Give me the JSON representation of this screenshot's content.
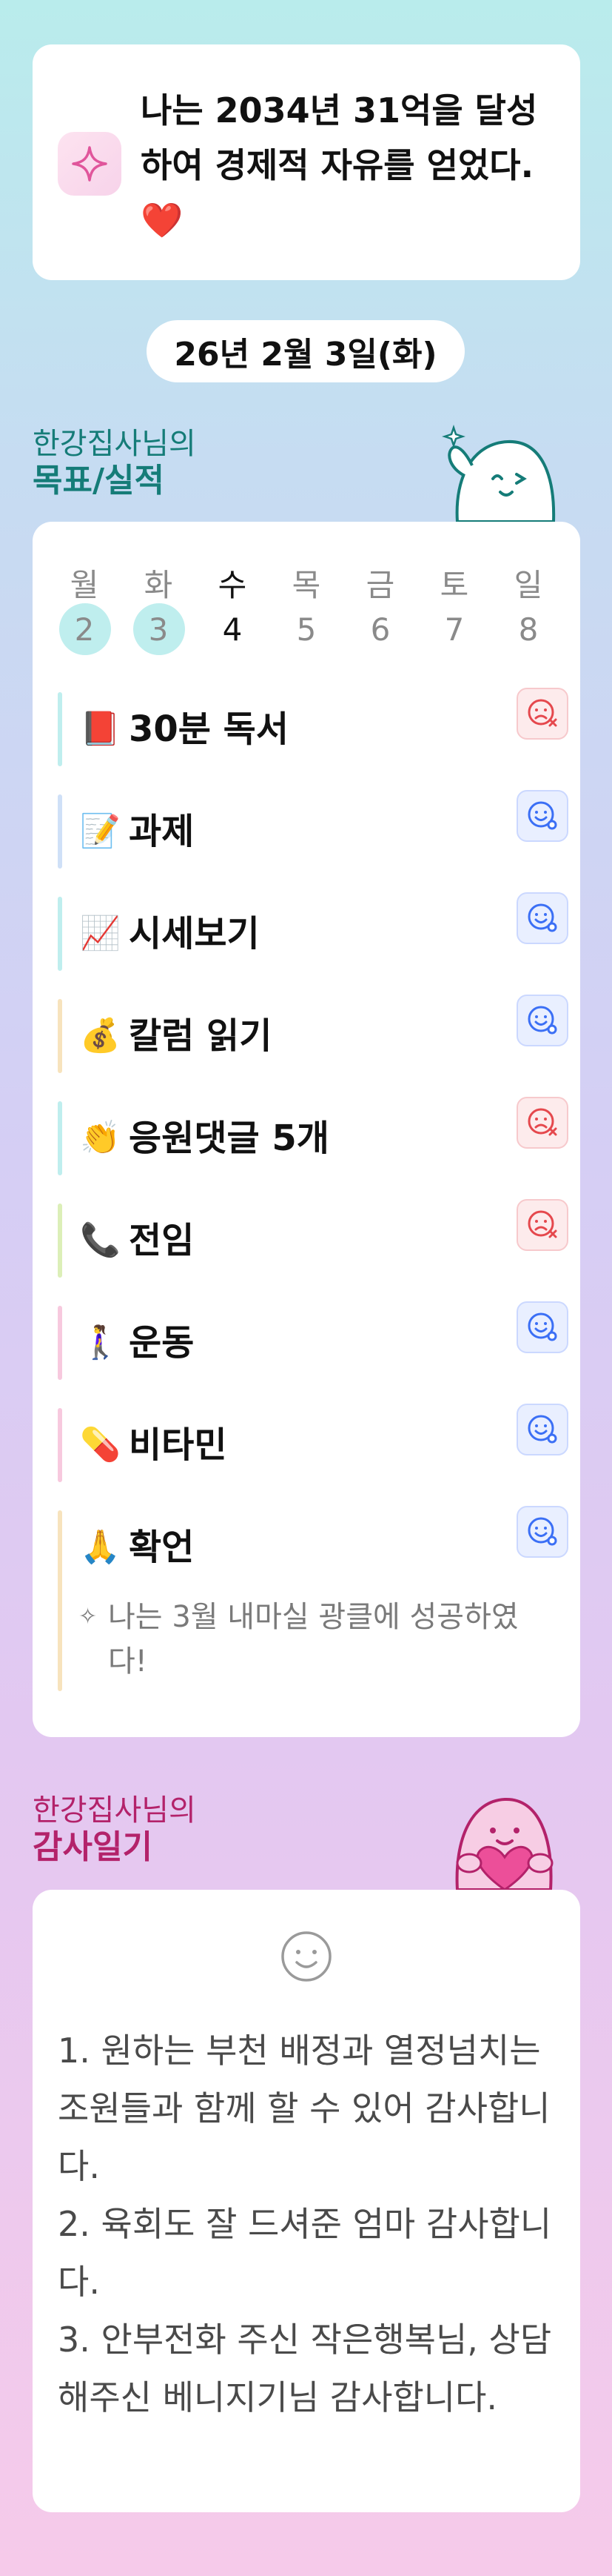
{
  "goal": {
    "text": "나는 2034년 31억을 달성하여 경제적 자유를 얻었다.❤️",
    "icon": "sparkle-icon"
  },
  "date": "26년 2월 3일(화)",
  "goals_section": {
    "subtitle": "한강집사님의",
    "title": "목표/실적"
  },
  "week": [
    {
      "name": "월",
      "num": "2",
      "marked": true,
      "strong": false
    },
    {
      "name": "화",
      "num": "3",
      "marked": true,
      "strong": false
    },
    {
      "name": "수",
      "num": "4",
      "marked": false,
      "strong": true
    },
    {
      "name": "목",
      "num": "5",
      "marked": false,
      "strong": false
    },
    {
      "name": "금",
      "num": "6",
      "marked": false,
      "strong": false
    },
    {
      "name": "토",
      "num": "7",
      "marked": false,
      "strong": false
    },
    {
      "name": "일",
      "num": "8",
      "marked": false,
      "strong": false
    }
  ],
  "tasks": [
    {
      "emoji": "📕",
      "label": "30분 독서",
      "status": "fail",
      "bar_color": "#bfeeee"
    },
    {
      "emoji": "📝",
      "label": "과제",
      "status": "done",
      "bar_color": "#cfe0f7"
    },
    {
      "emoji": "📈",
      "label": "시세보기",
      "status": "done",
      "bar_color": "#bfeeee"
    },
    {
      "emoji": "💰",
      "label": "칼럼 읽기",
      "status": "done",
      "bar_color": "#f7e3bd"
    },
    {
      "emoji": "👏",
      "label": "응원댓글 5개",
      "status": "fail",
      "bar_color": "#bfeeee"
    },
    {
      "emoji": "📞",
      "label": "전임",
      "status": "fail",
      "bar_color": "#dcefb8"
    },
    {
      "emoji": "🚶‍♀️",
      "label": "운동",
      "status": "done",
      "bar_color": "#f7c9de"
    },
    {
      "emoji": "💊",
      "label": "비타민",
      "status": "done",
      "bar_color": "#f7c9de"
    },
    {
      "emoji": "🙏",
      "label": "확언",
      "status": "done",
      "bar_color": "#f7e3bd"
    }
  ],
  "affirmation_note": "나는 3월 내마실 광클에 성공하였다!",
  "thanks_section": {
    "subtitle": "한강집사님의",
    "title": "감사일기"
  },
  "gratitude": "1. 원하는 부천 배정과 열정넘치는 조원들과 함께 할 수 있어 감사합니다.\n2. 육회도 잘 드셔준 엄마 감사합니다.\n3. 안부전화 주신 작은행복님, 상담해주신 베니지기님 감사합니다.",
  "colors": {
    "accent_teal": "#157c78",
    "accent_pink": "#b3226a",
    "fail": "#e5484d",
    "done": "#3b6ff5"
  }
}
